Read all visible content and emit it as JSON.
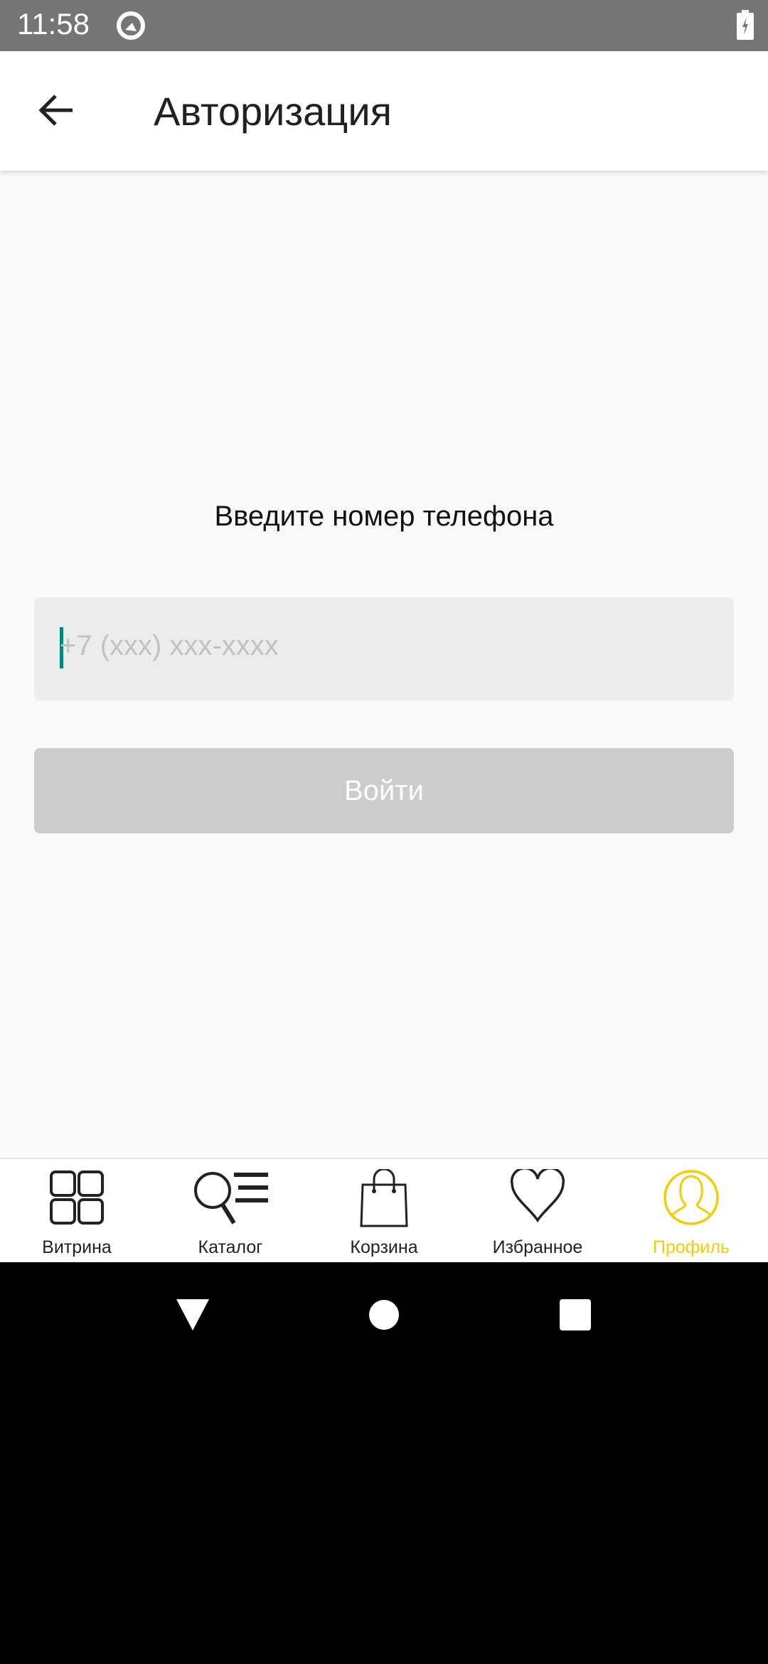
{
  "status_bar": {
    "time": "11:58"
  },
  "header": {
    "title": "Авторизация"
  },
  "main": {
    "prompt": "Введите номер телефона",
    "phone_input": {
      "value": "",
      "placeholder": "+7 (xxx) xxx-xxxx"
    },
    "login_button": "Войти"
  },
  "bottom_nav": {
    "items": [
      {
        "label": "Витрина",
        "icon": "grid-icon"
      },
      {
        "label": "Каталог",
        "icon": "catalog-search-icon"
      },
      {
        "label": "Корзина",
        "icon": "shopping-bag-icon"
      },
      {
        "label": "Избранное",
        "icon": "heart-icon"
      },
      {
        "label": "Профиль",
        "icon": "profile-icon",
        "active": true
      }
    ],
    "active_color": "#f5cc00"
  }
}
